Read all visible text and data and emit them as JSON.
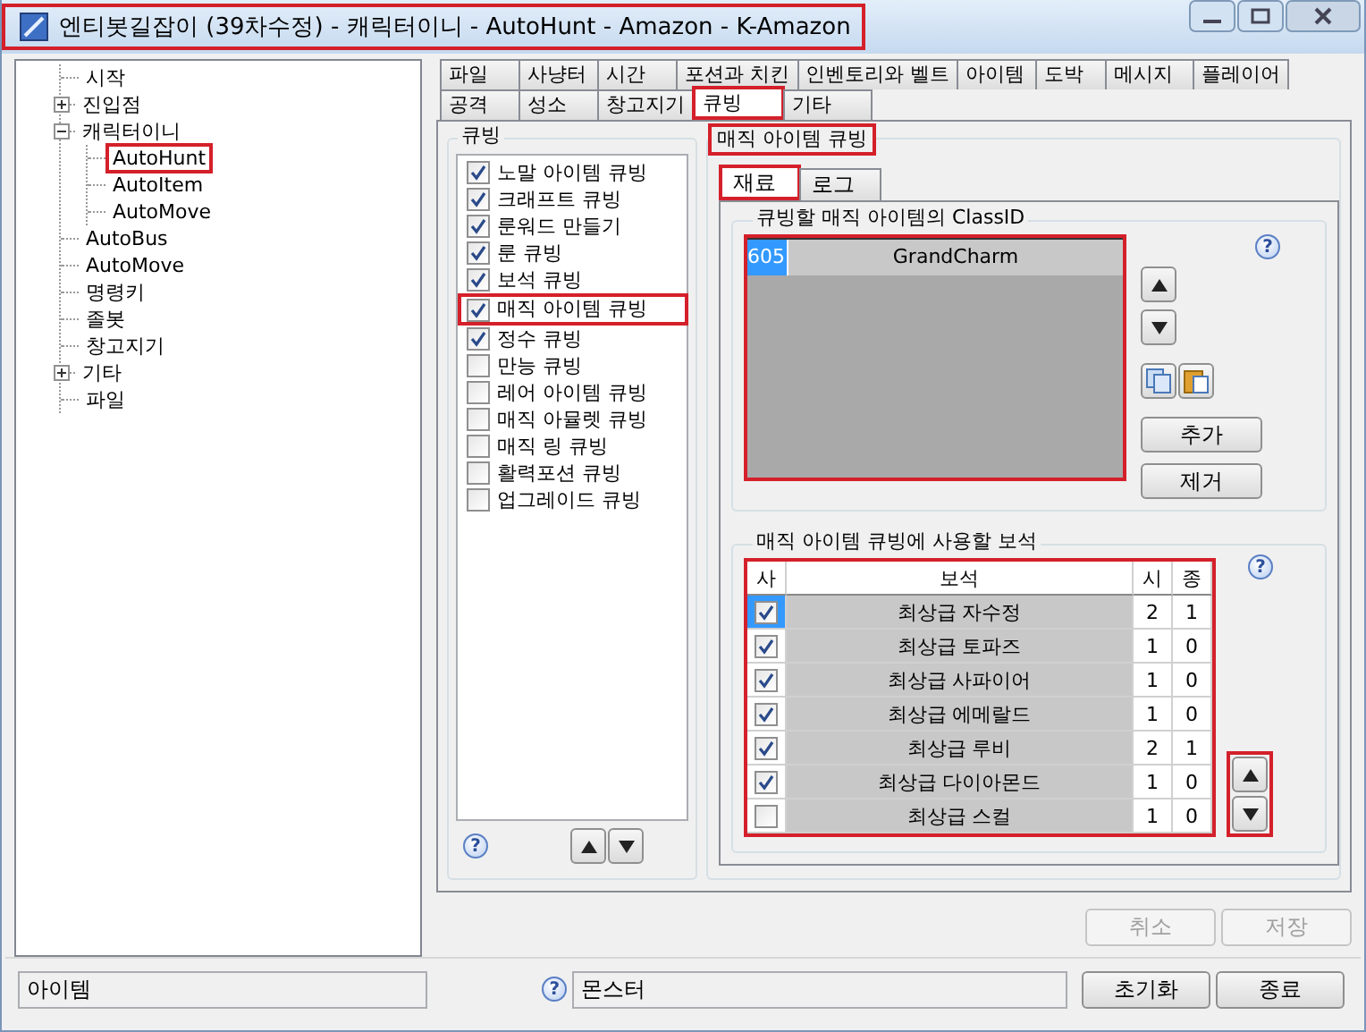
{
  "window": {
    "title": "엔티봇길잡이 (39차수정) - 캐릭터이니 - AutoHunt - Amazon - K-Amazon",
    "highlighted": true
  },
  "tree": [
    {
      "label": "시작",
      "highlighted": false
    },
    {
      "label": "진입점",
      "expanded": false,
      "highlighted": false
    },
    {
      "label": "캐릭터이니",
      "expanded": true,
      "highlighted": false,
      "children": [
        {
          "label": "AutoHunt",
          "highlighted": true
        },
        {
          "label": "AutoItem",
          "highlighted": false
        },
        {
          "label": "AutoMove",
          "highlighted": false
        }
      ]
    },
    {
      "label": "AutoBus",
      "highlighted": false
    },
    {
      "label": "AutoMove",
      "highlighted": false
    },
    {
      "label": "명령키",
      "highlighted": false
    },
    {
      "label": "졸봇",
      "highlighted": false
    },
    {
      "label": "창고지기",
      "highlighted": false
    },
    {
      "label": "기타",
      "expanded": false,
      "highlighted": false
    },
    {
      "label": "파일",
      "highlighted": false
    }
  ],
  "tabs": [
    [
      {
        "label": "파일",
        "selected": false,
        "highlighted": false
      },
      {
        "label": "사냥터",
        "selected": false,
        "highlighted": false
      },
      {
        "label": "시간",
        "selected": false,
        "highlighted": false
      },
      {
        "label": "포션과 치킨",
        "selected": false,
        "highlighted": false
      },
      {
        "label": "인벤토리와 벨트",
        "selected": false,
        "highlighted": false
      },
      {
        "label": "아이템",
        "selected": false,
        "highlighted": false
      },
      {
        "label": "도박",
        "selected": false,
        "highlighted": false
      },
      {
        "label": "메시지",
        "selected": false,
        "highlighted": false
      },
      {
        "label": "플레이어",
        "selected": false,
        "highlighted": false
      }
    ],
    [
      {
        "label": "공격",
        "selected": false,
        "highlighted": false
      },
      {
        "label": "성소",
        "selected": false,
        "highlighted": false
      },
      {
        "label": "창고지기",
        "selected": false,
        "highlighted": false
      },
      {
        "label": "큐빙",
        "selected": true,
        "highlighted": true
      },
      {
        "label": "기타",
        "selected": false,
        "highlighted": false
      }
    ]
  ],
  "cubing": {
    "title": "큐빙",
    "help": "?",
    "items": [
      {
        "label": "노말 아이템 큐빙",
        "checked": true,
        "highlighted": false
      },
      {
        "label": "크래프트 큐빙",
        "checked": true,
        "highlighted": false
      },
      {
        "label": "룬워드 만들기",
        "checked": true,
        "highlighted": false
      },
      {
        "label": "룬 큐빙",
        "checked": true,
        "highlighted": false
      },
      {
        "label": "보석 큐빙",
        "checked": true,
        "highlighted": false
      },
      {
        "label": "매직 아이템 큐빙",
        "checked": true,
        "highlighted": true
      },
      {
        "label": "정수 큐빙",
        "checked": true,
        "highlighted": false
      },
      {
        "label": "만능 큐빙",
        "checked": false,
        "highlighted": false
      },
      {
        "label": "레어 아이템 큐빙",
        "checked": false,
        "highlighted": false
      },
      {
        "label": "매직 아뮬렛 큐빙",
        "checked": false,
        "highlighted": false
      },
      {
        "label": "매직 링 큐빙",
        "checked": false,
        "highlighted": false
      },
      {
        "label": "활력포션 큐빙",
        "checked": false,
        "highlighted": false
      },
      {
        "label": "업그레이드 큐빙",
        "checked": false,
        "highlighted": false
      }
    ]
  },
  "magic": {
    "title": "매직 아이템 큐빙",
    "highlighted": true,
    "subtabs": [
      {
        "label": "재료",
        "selected": true,
        "highlighted": true
      },
      {
        "label": "로그",
        "selected": false,
        "highlighted": false
      }
    ],
    "classid": {
      "title": "큐빙할 매직 아이템의 ClassID",
      "highlighted": true,
      "help": "?",
      "rows": [
        {
          "id": "605",
          "name": "GrandCharm",
          "selected": true
        }
      ],
      "buttons": [
        "추가",
        "제거"
      ]
    },
    "gems": {
      "title": "매직 아이템 큐빙에 사용할 보석",
      "highlighted": true,
      "help": "?",
      "arrows_highlighted": true,
      "columns": [
        "사",
        "보석",
        "시",
        "종"
      ],
      "rows": [
        {
          "checked": true,
          "name": "최상급 자수정",
          "values": [
            "2",
            "1"
          ],
          "selected": true
        },
        {
          "checked": true,
          "name": "최상급 토파즈",
          "values": [
            "1",
            "0"
          ],
          "selected": false
        },
        {
          "checked": true,
          "name": "최상급 사파이어",
          "values": [
            "1",
            "0"
          ],
          "selected": false
        },
        {
          "checked": true,
          "name": "최상급 에메랄드",
          "values": [
            "1",
            "0"
          ],
          "selected": false
        },
        {
          "checked": true,
          "name": "최상급 루비",
          "values": [
            "2",
            "1"
          ],
          "selected": false
        },
        {
          "checked": true,
          "name": "최상급 다이아몬드",
          "values": [
            "1",
            "0"
          ],
          "selected": false
        },
        {
          "checked": false,
          "name": "최상급 스컬",
          "values": [
            "1",
            "0"
          ],
          "selected": false
        }
      ]
    }
  },
  "actions": [
    {
      "label": "취소",
      "disabled": true
    },
    {
      "label": "저장",
      "disabled": true
    }
  ],
  "status": {
    "item_field": {
      "value": "아이템"
    },
    "help": "?",
    "monster_field": {
      "value": "몬스터"
    },
    "buttons": [
      "초기화",
      "종료"
    ]
  }
}
